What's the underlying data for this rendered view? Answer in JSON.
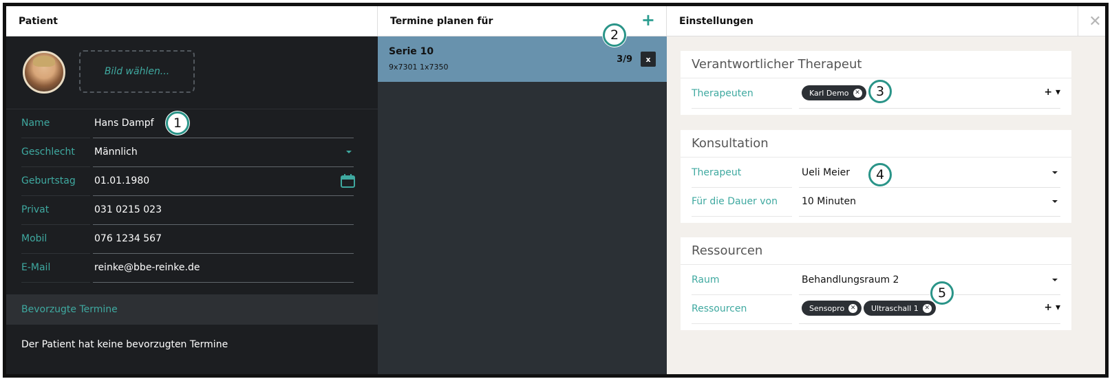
{
  "patient": {
    "header": "Patient",
    "photo_button": "Bild wählen...",
    "fields": [
      {
        "label": "Name",
        "value": "Hans Dampf"
      },
      {
        "label": "Geschlecht",
        "value": "Männlich"
      },
      {
        "label": "Geburtstag",
        "value": "01.01.1980"
      },
      {
        "label": "Privat",
        "value": "031 0215 023"
      },
      {
        "label": "Mobil",
        "value": "076 1234 567"
      },
      {
        "label": "E-Mail",
        "value": "reinke@bbe-reinke.de"
      }
    ],
    "preferred_header": "Bevorzugte Termine",
    "preferred_empty": "Der Patient hat keine bevorzugten Termine"
  },
  "planning": {
    "header": "Termine planen für",
    "add_icon": "+",
    "serie": {
      "title": "Serie 10",
      "subtitle": "9x7301 1x7350",
      "count": "3/9",
      "remove_icon": "x"
    }
  },
  "settings": {
    "header": "Einstellungen",
    "close_icon": "✕",
    "therapist_card": {
      "title": "Verantwortlicher Therapeut",
      "label": "Therapeuten",
      "chips": [
        "Karl Demo"
      ],
      "add_icon": "+ ▾"
    },
    "consultation_card": {
      "title": "Konsultation",
      "rows": [
        {
          "label": "Therapeut",
          "value": "Ueli  Meier"
        },
        {
          "label": "Für die Dauer von",
          "value": "10 Minuten"
        }
      ]
    },
    "resources_card": {
      "title": "Ressourcen",
      "room_label": "Raum",
      "room_value": "Behandlungsraum 2",
      "res_label": "Ressourcen",
      "chips": [
        "Sensopro",
        "Ultraschall 1"
      ],
      "add_icon": "+ ▾"
    }
  },
  "badges": [
    "1",
    "2",
    "3",
    "4",
    "5"
  ],
  "colors": {
    "accent": "#3fa9a0",
    "dark_bg": "#1c1e21",
    "serie_bg": "#6892ad",
    "settings_bg": "#f3f0ec"
  }
}
